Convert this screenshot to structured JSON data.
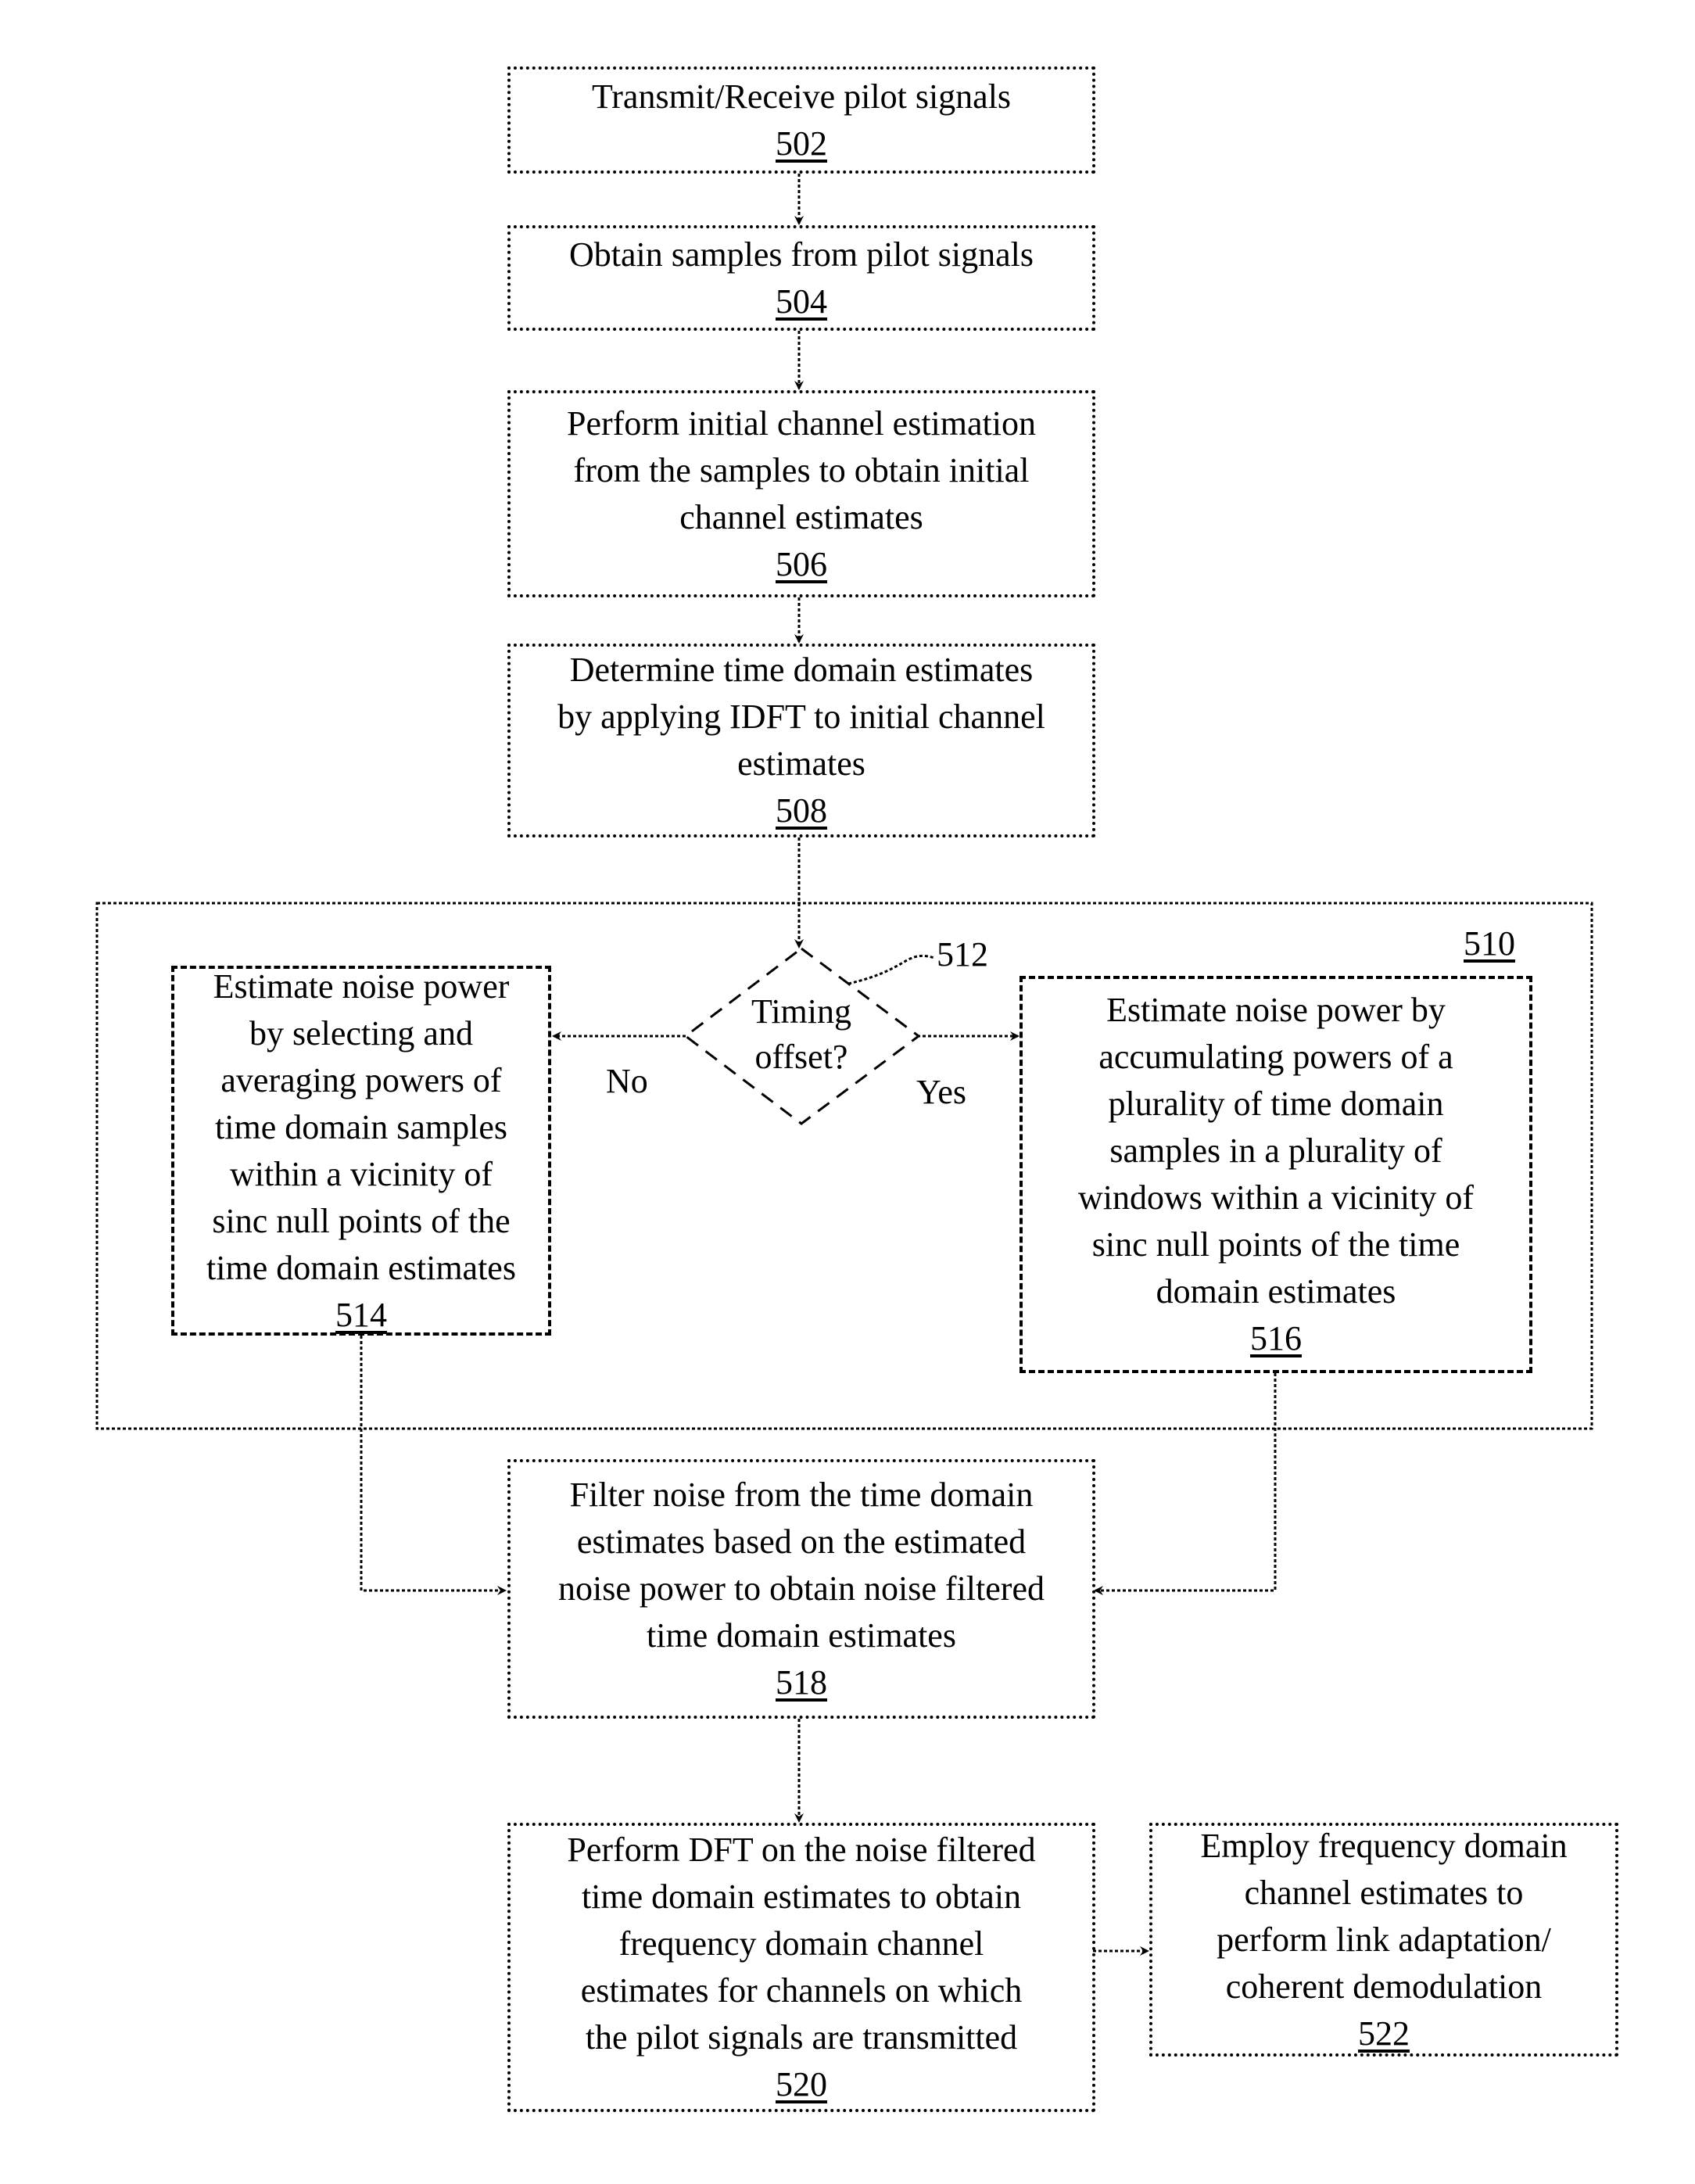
{
  "figure": {
    "steps": {
      "s502": {
        "text": [
          "Transmit/Receive pilot signals"
        ],
        "ref": "502"
      },
      "s504": {
        "text": [
          "Obtain samples from pilot signals"
        ],
        "ref": "504"
      },
      "s506": {
        "text": [
          "Perform initial channel estimation",
          "from the samples to obtain initial",
          "channel estimates"
        ],
        "ref": "506"
      },
      "s508": {
        "text": [
          "Determine time domain estimates",
          "by applying IDFT to initial channel",
          "estimates"
        ],
        "ref": "508"
      },
      "s514": {
        "text": [
          "Estimate noise power",
          "by selecting and",
          "averaging powers of",
          "time domain samples",
          "within a vicinity of",
          "sinc null points of the",
          "time domain estimates"
        ],
        "ref": "514"
      },
      "s516": {
        "text": [
          "Estimate noise power by",
          "accumulating powers of a",
          "plurality of time domain",
          "samples in a plurality of",
          "windows within a vicinity of",
          "sinc null points of the time",
          "domain estimates"
        ],
        "ref": "516"
      },
      "s518": {
        "text": [
          "Filter noise from the time domain",
          "estimates based on the estimated",
          "noise power to obtain noise filtered",
          "time domain estimates"
        ],
        "ref": "518"
      },
      "s520": {
        "text": [
          "Perform DFT on the noise filtered",
          "time domain estimates to obtain",
          "frequency domain channel",
          "estimates for channels on which",
          "the pilot signals are transmitted"
        ],
        "ref": "520"
      },
      "s522": {
        "text": [
          "Employ frequency domain",
          "channel estimates to",
          "perform link adaptation/",
          "coherent demodulation"
        ],
        "ref": "522"
      }
    },
    "decision": {
      "text": [
        "Timing",
        "offset?"
      ],
      "ref": "512",
      "no_label": "No",
      "yes_label": "Yes"
    },
    "group": {
      "ref": "510"
    }
  }
}
